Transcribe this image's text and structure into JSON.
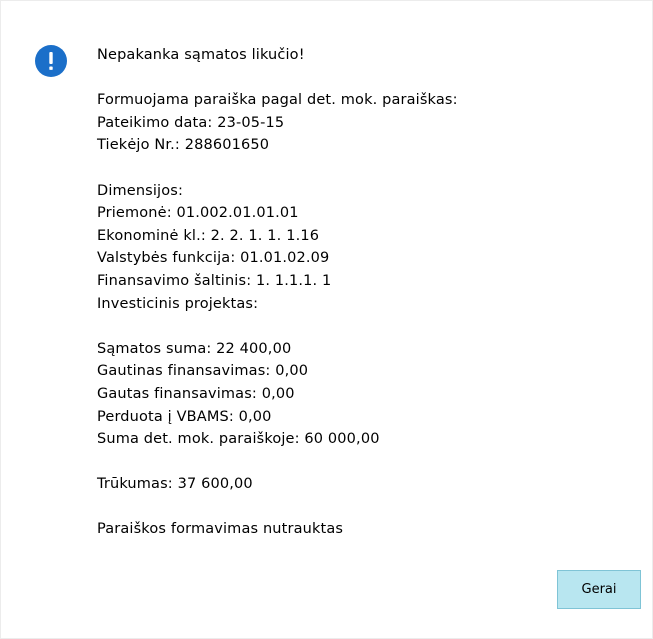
{
  "dialog": {
    "icon": "exclamation-info-icon",
    "accent_color": "#1b6fc9",
    "heading": "Nepakanka sąmatos likučio!",
    "block1": [
      "Formuojama paraiška pagal det. mok. paraiškas:",
      "Pateikimo data: 23-05-15",
      "Tiekėjo Nr.: 288601650"
    ],
    "block2": [
      "Dimensijos:",
      "Priemonė: 01.002.01.01.01",
      "Ekonominė kl.: 2. 2. 1. 1. 1.16",
      "Valstybės funkcija: 01.01.02.09",
      "Finansavimo šaltinis: 1. 1.1.1. 1",
      "Investicinis projektas:"
    ],
    "block3": [
      "Sąmatos suma: 22 400,00",
      "Gautinas finansavimas: 0,00",
      "Gautas finansavimas: 0,00",
      "Perduota į VBAMS: 0,00",
      "Suma det. mok. paraiškoje: 60 000,00"
    ],
    "shortage": "Trūkumas: 37 600,00",
    "footer": "Paraiškos formavimas nutrauktas",
    "ok_label": "Gerai",
    "button_color": "#b8e6f0"
  }
}
